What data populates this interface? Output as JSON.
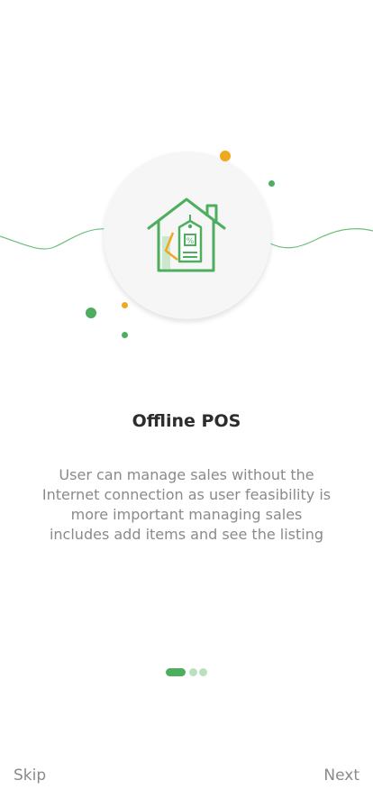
{
  "onboarding": {
    "title": "Offline POS",
    "description": "User can manage sales  without the Internet connection as user feasibility is more important managing sales includes add items and see the listing",
    "illustration_icon": "house-price-tag-icon"
  },
  "pager": {
    "current": 1,
    "total": 3
  },
  "footer": {
    "skip_label": "Skip",
    "next_label": "Next"
  },
  "colors": {
    "accent_green": "#4cae5e",
    "accent_orange": "#f0a81c",
    "text_dark": "#2d2d2d",
    "text_muted": "#8a8a8a"
  }
}
